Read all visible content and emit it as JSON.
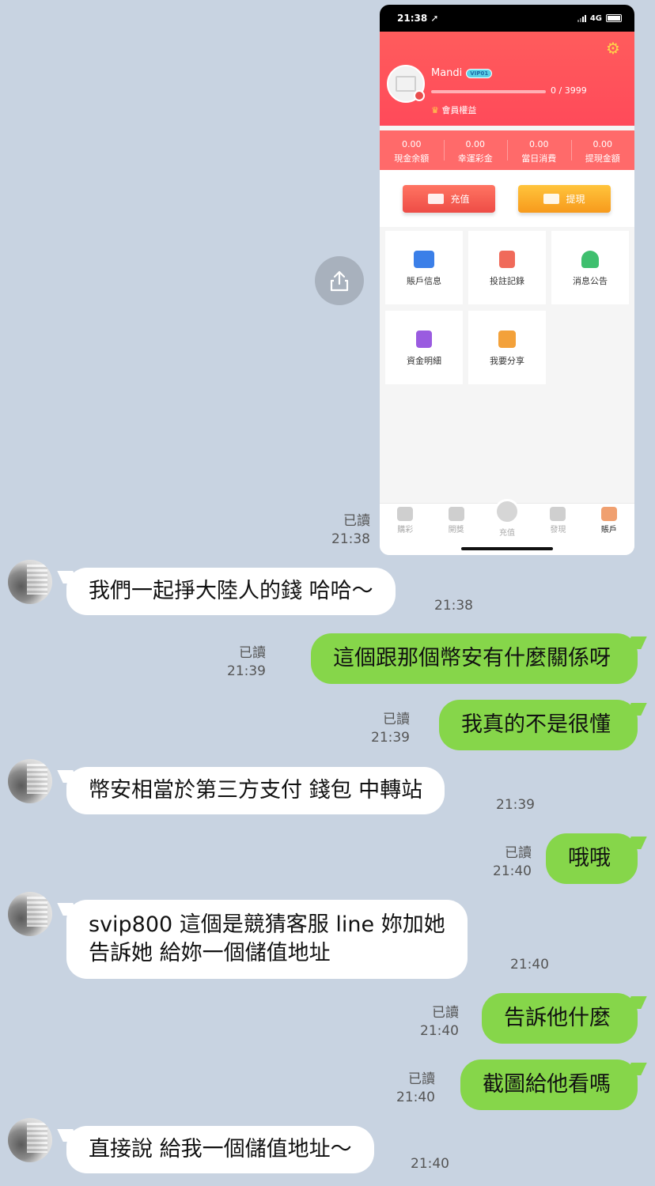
{
  "phone": {
    "status_time": "21:38 ➚",
    "network": "4G",
    "username": "Mandi",
    "vip": "VIP01",
    "progress_text": "0 / 3999",
    "progress": 0,
    "member_label": "會員權益",
    "stats": [
      {
        "value": "0.00",
        "label": "現金余額"
      },
      {
        "value": "0.00",
        "label": "幸運彩金"
      },
      {
        "value": "0.00",
        "label": "當日消費"
      },
      {
        "value": "0.00",
        "label": "提現金額"
      }
    ],
    "recharge_label": "充值",
    "withdraw_label": "提現",
    "tiles": [
      {
        "label": "賬戶信息",
        "color": "#3b7fe8"
      },
      {
        "label": "投註記錄",
        "color": "#f06a5a"
      },
      {
        "label": "消息公告",
        "color": "#3fbf6e"
      },
      {
        "label": "資金明細",
        "color": "#9a5be0"
      },
      {
        "label": "我要分享",
        "color": "#f3a13a"
      }
    ],
    "tabs": [
      "購彩",
      "開獎",
      "充值",
      "發現",
      "賬戶"
    ]
  },
  "messages": [
    {
      "side": "out-image",
      "read": "已讀",
      "time": "21:38"
    },
    {
      "side": "in",
      "text": "我們一起掙大陸人的錢 哈哈～",
      "time": "21:38"
    },
    {
      "side": "out",
      "text": "這個跟那個幣安有什麼關係呀",
      "read": "已讀",
      "time": "21:39"
    },
    {
      "side": "out",
      "text": "我真的不是很懂",
      "read": "已讀",
      "time": "21:39"
    },
    {
      "side": "in",
      "text": "幣安相當於第三方支付 錢包 中轉站",
      "time": "21:39"
    },
    {
      "side": "out",
      "text": "哦哦",
      "read": "已讀",
      "time": "21:40"
    },
    {
      "side": "in",
      "line1": "svip800 這個是競猜客服 line 妳加她",
      "line2": "告訴她 給妳一個儲值地址",
      "time": "21:40"
    },
    {
      "side": "out",
      "text": "告訴他什麼",
      "read": "已讀",
      "time": "21:40"
    },
    {
      "side": "out",
      "text": "截圖給他看嗎",
      "read": "已讀",
      "time": "21:40"
    },
    {
      "side": "in",
      "text": "直接說 給我一個儲值地址～",
      "time": "21:40"
    }
  ]
}
